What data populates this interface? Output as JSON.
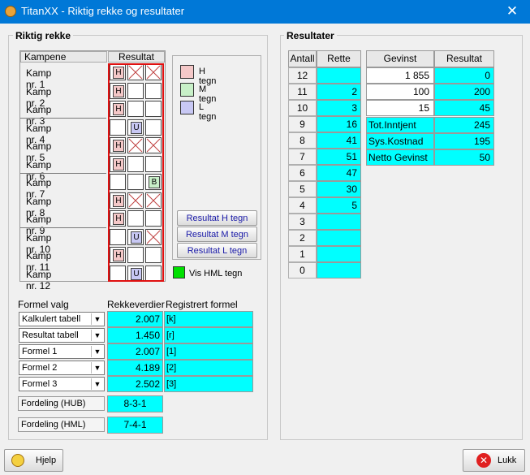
{
  "window": {
    "title": "TitanXX - Riktig rekke og resultater",
    "close": "✕"
  },
  "left_group": {
    "title": "Riktig rekke"
  },
  "right_group": {
    "title": "Resultater"
  },
  "matches_header": {
    "kampene": "Kampene",
    "resultat": "Resultat"
  },
  "matches": [
    {
      "label": "Kamp nr. 1",
      "cells": [
        "H",
        "x",
        "x"
      ]
    },
    {
      "label": "Kamp nr. 2",
      "cells": [
        "H",
        "",
        ""
      ]
    },
    {
      "label": "Kamp nr. 3",
      "cells": [
        "H",
        "",
        ""
      ]
    },
    {
      "label": "Kamp nr. 4",
      "cells": [
        "",
        "U",
        ""
      ]
    },
    {
      "label": "Kamp nr. 5",
      "cells": [
        "H",
        "x",
        "x"
      ]
    },
    {
      "label": "Kamp nr. 6",
      "cells": [
        "H",
        "",
        ""
      ]
    },
    {
      "label": "Kamp nr. 7",
      "cells": [
        "",
        "",
        "B"
      ]
    },
    {
      "label": "Kamp nr. 8",
      "cells": [
        "H",
        "x",
        "x"
      ]
    },
    {
      "label": "Kamp nr. 9",
      "cells": [
        "H",
        "",
        ""
      ]
    },
    {
      "label": "Kamp nr. 10",
      "cells": [
        "",
        "U",
        "x"
      ]
    },
    {
      "label": "Kamp nr. 11",
      "cells": [
        "H",
        "",
        ""
      ]
    },
    {
      "label": "Kamp nr. 12",
      "cells": [
        "",
        "U",
        ""
      ]
    }
  ],
  "legend": [
    {
      "label": "H tegn",
      "color": "#f4c8c8"
    },
    {
      "label": "M tegn",
      "color": "#c8f0c8"
    },
    {
      "label": "L tegn",
      "color": "#c8c8f4"
    }
  ],
  "buttons": {
    "resultat_h": "Resultat H tegn",
    "resultat_m": "Resultat M tegn",
    "resultat_l": "Resultat L tegn"
  },
  "vis_hml": {
    "label": "Vis HML tegn",
    "color": "#00e000"
  },
  "formel": {
    "header_valg": "Formel valg",
    "header_rekkeverdier": "Rekkeverdier",
    "header_registrert": "Registrert formel",
    "rows": [
      {
        "select": "Kalkulert tabell",
        "value": "2.007",
        "formula": "[k]"
      },
      {
        "select": "Resultat tabell",
        "value": "1.450",
        "formula": "[r]"
      },
      {
        "select": "Formel 1",
        "value": "2.007",
        "formula": "[1]"
      },
      {
        "select": "Formel 2",
        "value": "4.189",
        "formula": "[2]"
      },
      {
        "select": "Formel 3",
        "value": "2.502",
        "formula": "[3]"
      }
    ]
  },
  "fordeling": [
    {
      "label": "Fordeling (HUB)",
      "value": "8-3-1"
    },
    {
      "label": "Fordeling (HML)",
      "value": "7-4-1"
    }
  ],
  "antall_table": {
    "headers": [
      "Antall",
      "Rette"
    ],
    "rows": [
      [
        "12",
        ""
      ],
      [
        "11",
        "2"
      ],
      [
        "10",
        "3"
      ],
      [
        "9",
        "16"
      ],
      [
        "8",
        "41"
      ],
      [
        "7",
        "51"
      ],
      [
        "6",
        "47"
      ],
      [
        "5",
        "30"
      ],
      [
        "4",
        "5"
      ],
      [
        "3",
        ""
      ],
      [
        "2",
        ""
      ],
      [
        "1",
        ""
      ],
      [
        "0",
        ""
      ]
    ]
  },
  "gevinst_table": {
    "headers": [
      "Gevinst",
      "Resultat"
    ],
    "rows": [
      [
        "1 855",
        "0"
      ],
      [
        "100",
        "200"
      ],
      [
        "15",
        "45"
      ]
    ]
  },
  "summary": [
    {
      "label": "Tot.Inntjent",
      "value": "245"
    },
    {
      "label": "Sys.Kostnad",
      "value": "195"
    },
    {
      "label": "Netto Gevinst",
      "value": "50"
    }
  ],
  "footer": {
    "help": "Hjelp",
    "close": "Lukk"
  }
}
